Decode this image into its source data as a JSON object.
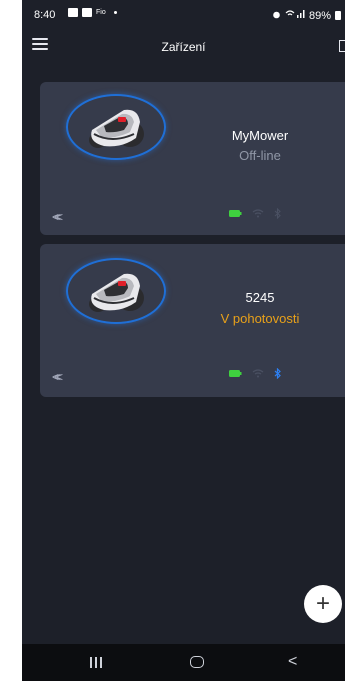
{
  "status_bar": {
    "time": "8:40",
    "small_label": "Fio",
    "battery_percent": "89%"
  },
  "app_bar": {
    "title": "Zařízení",
    "menu_icon": "hamburger-menu-icon"
  },
  "devices": [
    {
      "name": "MyMower",
      "status": "Off-line",
      "status_color": "#9097a6",
      "battery_color": "#3fd13f",
      "wifi_color": "#4a5062",
      "bluetooth_color": "#4a5062"
    },
    {
      "name": "5245",
      "status": "V pohotovosti",
      "status_color": "#e8a11a",
      "battery_color": "#3fd13f",
      "wifi_color": "#4a5062",
      "bluetooth_color": "#2d7ff0"
    }
  ],
  "fab": {
    "label": "+"
  },
  "nav_bar": {
    "back_glyph": "<"
  }
}
